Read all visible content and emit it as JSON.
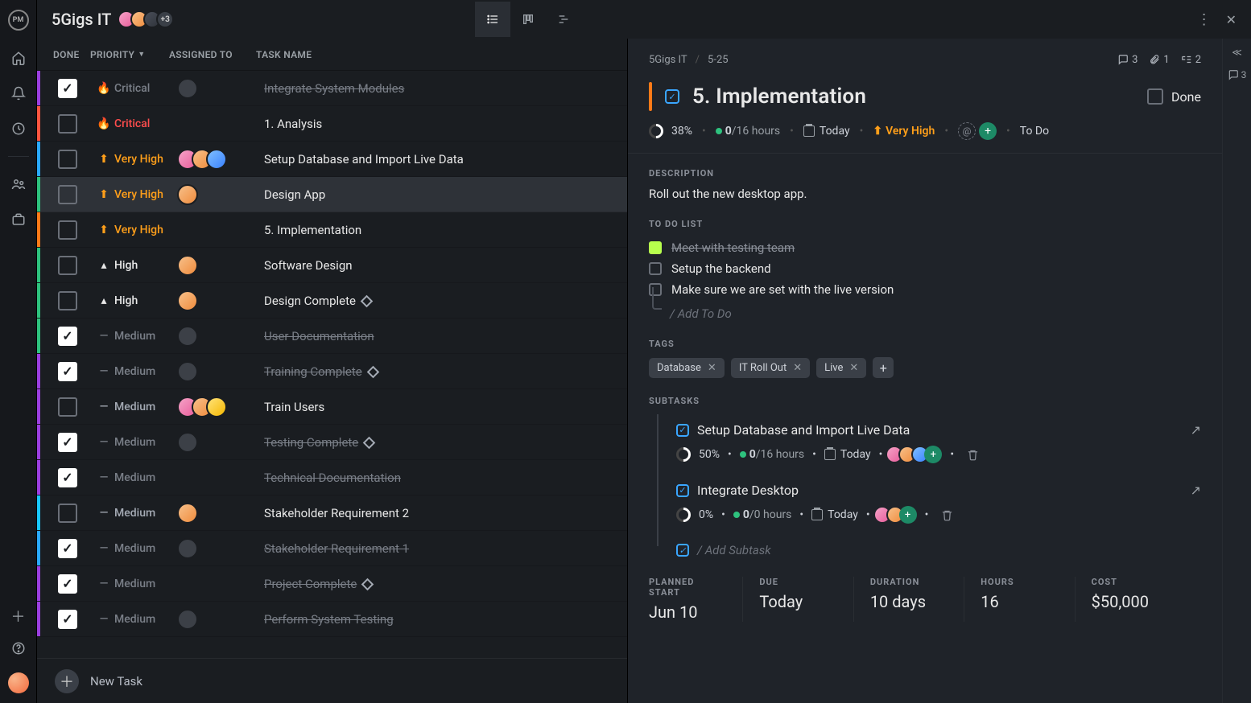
{
  "project": {
    "title": "5Gigs IT",
    "extra_members": "+3"
  },
  "columns": {
    "done": "DONE",
    "priority": "PRIORITY",
    "assigned": "ASSIGNED TO",
    "taskname": "TASK NAME"
  },
  "newTask": "New Task",
  "rows": [
    {
      "stripe": "s-purple",
      "done": true,
      "prio": "Critical",
      "prioClass": "prio-critical",
      "picon": "🔥",
      "name": "Integrate System Modules",
      "avatars": [
        "av-grey"
      ]
    },
    {
      "stripe": "s-red",
      "done": false,
      "prio": "Critical",
      "prioClass": "prio-critical",
      "picon": "🔥",
      "name": "1. Analysis",
      "avatars": []
    },
    {
      "stripe": "s-blue",
      "done": false,
      "prio": "Very High",
      "prioClass": "prio-veryhigh",
      "picon": "⬆",
      "name": "Setup Database and Import Live Data",
      "avatars": [
        "av-pink",
        "av-orange",
        "av-blue"
      ]
    },
    {
      "stripe": "s-green",
      "done": false,
      "prio": "Very High",
      "prioClass": "prio-veryhigh",
      "picon": "⬆",
      "name": "Design App",
      "avatars": [
        "av-orange"
      ],
      "highlight": true
    },
    {
      "stripe": "s-orange",
      "done": false,
      "prio": "Very High",
      "prioClass": "prio-veryhigh",
      "picon": "⬆",
      "name": "5. Implementation",
      "avatars": []
    },
    {
      "stripe": "s-green",
      "done": false,
      "prio": "High",
      "prioClass": "prio-high",
      "picon": "▴",
      "name": "Software Design",
      "avatars": [
        "av-orange"
      ]
    },
    {
      "stripe": "s-green",
      "done": false,
      "prio": "High",
      "prioClass": "prio-high",
      "picon": "▴",
      "name": "Design Complete",
      "avatars": [
        "av-orange"
      ],
      "milestone": true
    },
    {
      "stripe": "s-green",
      "done": true,
      "prio": "Medium",
      "prioClass": "prio-med",
      "picon": "—",
      "name": "User Documentation",
      "avatars": [
        "av-grey"
      ]
    },
    {
      "stripe": "s-purple",
      "done": true,
      "prio": "Medium",
      "prioClass": "prio-med",
      "picon": "—",
      "name": "Training Complete",
      "avatars": [
        "av-grey"
      ],
      "milestone": true
    },
    {
      "stripe": "s-purple",
      "done": false,
      "prio": "Medium",
      "prioClass": "prio-med",
      "picon": "—",
      "name": "Train Users",
      "avatars": [
        "av-pink",
        "av-orange",
        "av-yellow"
      ]
    },
    {
      "stripe": "s-purple",
      "done": true,
      "prio": "Medium",
      "prioClass": "prio-med",
      "picon": "—",
      "name": "Testing Complete",
      "avatars": [
        "av-grey"
      ],
      "milestone": true
    },
    {
      "stripe": "s-purple",
      "done": true,
      "prio": "Medium",
      "prioClass": "prio-med",
      "picon": "—",
      "name": "Technical Documentation",
      "avatars": []
    },
    {
      "stripe": "s-cyan",
      "done": false,
      "prio": "Medium",
      "prioClass": "prio-med",
      "picon": "—",
      "name": "Stakeholder Requirement 2",
      "avatars": [
        "av-orange"
      ]
    },
    {
      "stripe": "s-blue",
      "done": true,
      "prio": "Medium",
      "prioClass": "prio-med",
      "picon": "—",
      "name": "Stakeholder Requirement 1",
      "avatars": [
        "av-grey"
      ]
    },
    {
      "stripe": "s-purple",
      "done": true,
      "prio": "Medium",
      "prioClass": "prio-med",
      "picon": "—",
      "name": "Project Complete",
      "avatars": [],
      "milestone": true
    },
    {
      "stripe": "s-purple",
      "done": true,
      "prio": "Medium",
      "prioClass": "prio-med",
      "picon": "—",
      "name": "Perform System Testing",
      "avatars": [
        "av-grey"
      ]
    }
  ],
  "detail": {
    "crumb1": "5Gigs IT",
    "crumb2": "5-25",
    "counts": {
      "comments": "3",
      "attachments": "1",
      "subtasks": "2"
    },
    "title": "5. Implementation",
    "doneLabel": "Done",
    "pct": "38%",
    "hoursDone": "0",
    "hoursTotal": "/16 hours",
    "date": "Today",
    "priority": "Very High",
    "status": "To Do",
    "descHeading": "DESCRIPTION",
    "desc": "Roll out the new desktop app.",
    "todoHeading": "TO DO LIST",
    "todos": [
      {
        "done": true,
        "text": "Meet with testing team"
      },
      {
        "done": false,
        "text": "Setup the backend"
      },
      {
        "done": false,
        "text": "Make sure we are set with the live version"
      }
    ],
    "todoAdd": "/ Add To Do",
    "tagsHeading": "TAGS",
    "tags": [
      "Database",
      "IT Roll Out",
      "Live"
    ],
    "subHeading": "SUBTASKS",
    "subtasks": [
      {
        "name": "Setup Database and Import Live Data",
        "pct": "50%",
        "hoursDone": "0",
        "hoursTotal": "/16 hours",
        "date": "Today",
        "avatars": [
          "av-pink",
          "av-orange",
          "av-blue"
        ]
      },
      {
        "name": "Integrate Desktop",
        "pct": "0%",
        "hoursDone": "0",
        "hoursTotal": "/0 hours",
        "date": "Today",
        "avatars": [
          "av-pink",
          "av-orange"
        ]
      }
    ],
    "subAdd": "/ Add Subtask",
    "stats": {
      "plannedStartL": "PLANNED START",
      "plannedStart": "Jun 10",
      "dueL": "DUE",
      "due": "Today",
      "durationL": "DURATION",
      "duration": "10 days",
      "hoursL": "HOURS",
      "hours": "16",
      "costL": "COST",
      "cost": "$50,000"
    },
    "sideCount": "3"
  }
}
